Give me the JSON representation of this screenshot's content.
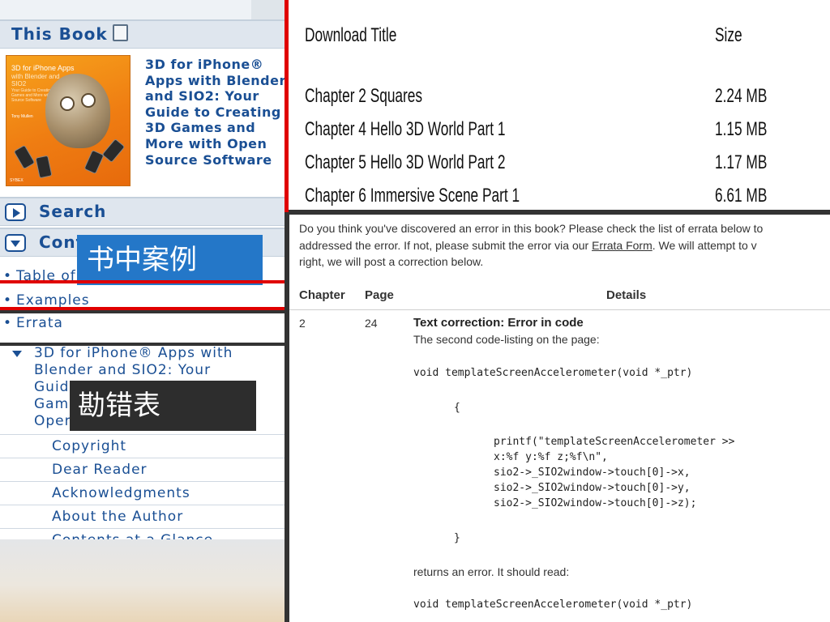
{
  "sidebar": {
    "this_book_label": "This Book",
    "book_cover": {
      "title_line": "3D for iPhone Apps",
      "subtitle_line": "with Blender and SIO2",
      "fine_print": "Your Guide to Creating 3D Games and More with Open Source Software",
      "author": "Tony Mullen",
      "publisher": "SYBEX"
    },
    "book_title_lines": [
      "3D for iPhone®",
      "Apps with Blender",
      "and SIO2: Your",
      "Guide to Creating",
      "3D Games and",
      "More with Open",
      "Source Software"
    ],
    "search_label": "Search",
    "contents_label": "Contents",
    "list_items": [
      "Table of Contents",
      "Examples",
      "Errata"
    ],
    "tree_parent_lines": [
      "3D for iPhone® Apps with",
      "Blender and SIO2: Your",
      "Guide to Creating 3D",
      "Games and More with",
      "Open Source Software"
    ],
    "tree_children": [
      "Copyright",
      "Dear Reader",
      "Acknowledgments",
      "About the Author",
      "Contents at a Glance"
    ]
  },
  "annotations": {
    "examples_cn": "书中案例",
    "errata_cn": "勘错表"
  },
  "downloads": {
    "header_title": "Download Title",
    "header_size": "Size",
    "rows": [
      {
        "title": "Chapter 2 Squares",
        "size": "2.24 MB"
      },
      {
        "title": "Chapter 4 Hello 3D World Part 1",
        "size": "1.15 MB"
      },
      {
        "title": "Chapter 5 Hello 3D World Part 2",
        "size": "1.17 MB"
      },
      {
        "title": "Chapter 6 Immersive Scene Part 1",
        "size": "6.61 MB"
      }
    ]
  },
  "errata": {
    "intro_line1": "Do you think you've discovered an error in this book? Please check the list of errata below to",
    "intro_line2_pre": "addressed the error. If not, please submit the error via our ",
    "intro_link": "Errata Form",
    "intro_line2_post": ". We will attempt to v",
    "intro_line3": "right, we will post a correction below.",
    "columns": {
      "chapter": "Chapter",
      "page": "Page",
      "details": "Details"
    },
    "entry": {
      "chapter": "2",
      "page": "24",
      "title": "Text correction: Error in code",
      "intro": "The second code-listing on the page:",
      "code_signature": "void templateScreenAccelerometer(void *_ptr)",
      "brace_open": "{",
      "code_body": "printf(\"templateScreenAccelerometer >>\nx:%f y:%f z;%f\\n\",\nsio2->_SIO2window->touch[0]->x,\nsio2->_SIO2window->touch[0]->y,\nsio2->_SIO2window->touch[0]->z);",
      "brace_close": "}",
      "returns_text": "returns an error. It should read:",
      "code_signature_2": "void templateScreenAccelerometer(void *_ptr)"
    }
  },
  "colors": {
    "sidebar_link": "#1a4f94",
    "highlight_red": "#e00000",
    "highlight_dark": "#333333",
    "annotation_blue": "#2477c8"
  }
}
